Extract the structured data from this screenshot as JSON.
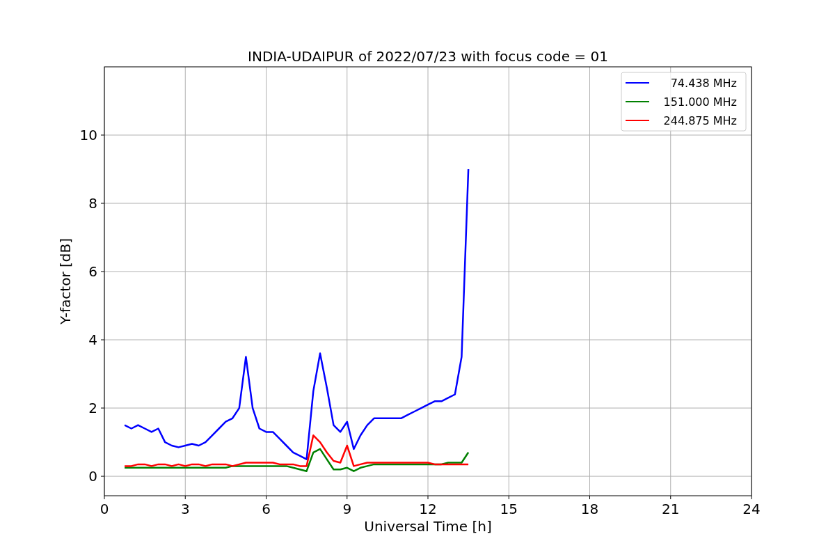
{
  "chart_data": {
    "type": "line",
    "title": "INDIA-UDAIPUR of 2022/07/23 with focus code = 01",
    "xlabel": "Universal Time [h]",
    "ylabel": "Y-factor [dB]",
    "x": [
      0.75,
      1,
      1.25,
      1.5,
      1.75,
      2,
      2.25,
      2.5,
      2.75,
      3,
      3.25,
      3.5,
      3.75,
      4,
      4.25,
      4.5,
      4.75,
      5,
      5.25,
      5.5,
      5.75,
      6,
      6.25,
      6.5,
      6.75,
      7,
      7.25,
      7.5,
      7.75,
      8,
      8.25,
      8.5,
      8.75,
      9,
      9.25,
      9.5,
      9.75,
      10,
      10.25,
      10.5,
      10.75,
      11,
      11.25,
      11.5,
      11.75,
      12,
      12.25,
      12.5,
      12.75,
      13,
      13.25,
      13.5
    ],
    "series": [
      {
        "name": "74.438 MHz",
        "color": "#0000ff",
        "values": [
          1.5,
          1.4,
          1.5,
          1.4,
          1.3,
          1.4,
          1.0,
          0.9,
          0.85,
          0.9,
          0.95,
          0.9,
          1.0,
          1.2,
          1.4,
          1.6,
          1.7,
          2.0,
          3.5,
          2.0,
          1.4,
          1.3,
          1.3,
          1.1,
          0.9,
          0.7,
          0.6,
          0.5,
          2.5,
          3.6,
          2.6,
          1.5,
          1.3,
          1.6,
          0.8,
          1.2,
          1.5,
          1.7,
          1.7,
          1.7,
          1.7,
          1.7,
          1.8,
          1.9,
          2.0,
          2.1,
          2.2,
          2.2,
          2.3,
          2.4,
          3.5,
          9.0
        ]
      },
      {
        "name": "151.000 MHz",
        "color": "#008000",
        "values": [
          0.25,
          0.25,
          0.25,
          0.25,
          0.25,
          0.25,
          0.25,
          0.25,
          0.25,
          0.25,
          0.25,
          0.25,
          0.25,
          0.25,
          0.25,
          0.25,
          0.3,
          0.3,
          0.3,
          0.3,
          0.3,
          0.3,
          0.3,
          0.3,
          0.3,
          0.25,
          0.2,
          0.15,
          0.7,
          0.8,
          0.5,
          0.2,
          0.2,
          0.25,
          0.15,
          0.25,
          0.3,
          0.35,
          0.35,
          0.35,
          0.35,
          0.35,
          0.35,
          0.35,
          0.35,
          0.35,
          0.35,
          0.35,
          0.4,
          0.4,
          0.4,
          0.7
        ]
      },
      {
        "name": "244.875 MHz",
        "color": "#ff0000",
        "values": [
          0.3,
          0.3,
          0.35,
          0.35,
          0.3,
          0.35,
          0.35,
          0.3,
          0.35,
          0.3,
          0.35,
          0.35,
          0.3,
          0.35,
          0.35,
          0.35,
          0.3,
          0.35,
          0.4,
          0.4,
          0.4,
          0.4,
          0.4,
          0.35,
          0.35,
          0.35,
          0.3,
          0.3,
          1.2,
          1.0,
          0.7,
          0.45,
          0.4,
          0.9,
          0.3,
          0.35,
          0.4,
          0.4,
          0.4,
          0.4,
          0.4,
          0.4,
          0.4,
          0.4,
          0.4,
          0.4,
          0.35,
          0.35,
          0.35,
          0.35,
          0.35,
          0.35
        ]
      }
    ],
    "xlim": [
      0,
      24
    ],
    "ylim": [
      -0.57,
      12
    ],
    "xticks": [
      0,
      3,
      6,
      9,
      12,
      15,
      18,
      21,
      24
    ],
    "yticks": [
      0,
      2,
      4,
      6,
      8,
      10
    ],
    "grid": true,
    "legend": "upper right"
  }
}
